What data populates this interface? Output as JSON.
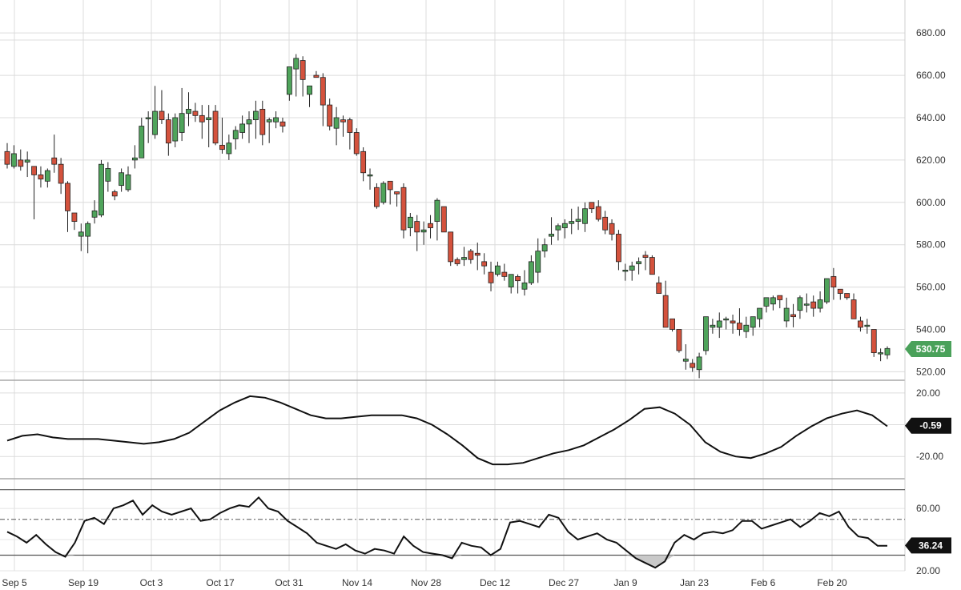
{
  "chart_data": [
    {
      "type": "candlestick",
      "x_tick_labels": [
        "Sep 5",
        "Sep 19",
        "Oct 3",
        "Oct 17",
        "Oct 31",
        "Nov 14",
        "Nov 28",
        "Dec 12",
        "Dec 27",
        "Jan 9",
        "Jan 23",
        "Feb 6",
        "Feb 20"
      ],
      "y_tick_labels": [
        "520.00",
        "540.00",
        "560.00",
        "580.00",
        "600.00",
        "620.00",
        "640.00",
        "660.00",
        "680.00"
      ],
      "ylim": [
        516,
        688
      ],
      "last_value_label": "530.75",
      "last_value": 530.75,
      "grid": true,
      "colors": {
        "up": "#4fa45b",
        "down": "#d4523d",
        "badge": "#4aa15a"
      },
      "candles": [
        [
          624,
          628,
          616,
          618
        ],
        [
          617,
          627,
          616,
          623
        ],
        [
          620,
          625,
          615,
          617
        ],
        [
          619,
          624,
          612,
          620
        ],
        [
          617,
          616,
          592,
          613
        ],
        [
          613,
          617,
          607,
          611
        ],
        [
          610,
          616,
          607,
          615
        ],
        [
          621,
          632,
          614,
          618
        ],
        [
          618,
          621,
          604,
          609
        ],
        [
          609,
          610,
          586,
          596
        ],
        [
          595,
          592,
          587,
          591
        ],
        [
          584,
          590,
          577,
          586
        ],
        [
          584,
          591,
          576,
          590
        ],
        [
          593,
          601,
          590,
          596
        ],
        [
          594,
          620,
          593,
          618
        ],
        [
          610,
          619,
          605,
          616
        ],
        [
          605,
          606,
          601,
          603
        ],
        [
          608,
          616,
          605,
          614
        ],
        [
          606,
          617,
          605,
          613
        ],
        [
          620,
          627,
          616,
          621
        ],
        [
          621,
          640,
          621,
          636
        ],
        [
          640,
          643,
          628,
          640
        ],
        [
          632,
          655,
          630,
          643
        ],
        [
          643,
          653,
          637,
          639
        ],
        [
          639,
          642,
          622,
          628
        ],
        [
          629,
          642,
          626,
          640
        ],
        [
          633,
          654,
          629,
          642
        ],
        [
          642,
          652,
          636,
          644
        ],
        [
          643,
          647,
          638,
          641
        ],
        [
          641,
          646,
          630,
          638
        ],
        [
          639,
          646,
          626,
          640
        ],
        [
          643,
          646,
          627,
          628
        ],
        [
          627,
          640,
          623,
          625
        ],
        [
          623,
          632,
          620,
          628
        ],
        [
          630,
          636,
          625,
          634
        ],
        [
          633,
          641,
          630,
          637
        ],
        [
          637,
          643,
          628,
          639
        ],
        [
          639,
          648,
          630,
          643
        ],
        [
          644,
          648,
          627,
          632
        ],
        [
          638,
          640,
          628,
          639
        ],
        [
          638,
          643,
          635,
          640
        ],
        [
          638,
          640,
          633,
          636
        ],
        [
          651,
          663,
          648,
          664
        ],
        [
          663,
          670,
          650,
          668
        ],
        [
          667,
          669,
          650,
          658
        ],
        [
          651,
          652,
          645,
          655
        ],
        [
          660,
          662,
          660,
          659
        ],
        [
          659,
          661,
          636,
          646
        ],
        [
          646,
          649,
          634,
          636
        ],
        [
          635,
          645,
          627,
          640
        ],
        [
          639,
          641,
          631,
          638
        ],
        [
          639,
          640,
          625,
          633
        ],
        [
          633,
          635,
          622,
          623
        ],
        [
          624,
          626,
          610,
          614
        ],
        [
          613,
          616,
          606,
          613
        ],
        [
          607,
          609,
          597,
          598
        ],
        [
          600,
          610,
          599,
          609
        ],
        [
          610,
          608,
          599,
          606
        ],
        [
          605,
          602,
          598,
          604
        ],
        [
          607,
          609,
          583,
          587
        ],
        [
          588,
          595,
          584,
          593
        ],
        [
          591,
          594,
          577,
          586
        ],
        [
          586,
          591,
          580,
          587
        ],
        [
          590,
          594,
          583,
          588
        ],
        [
          591,
          602,
          582,
          601
        ],
        [
          598,
          596,
          587,
          586
        ],
        [
          586,
          585,
          570,
          572
        ],
        [
          573,
          574,
          570,
          571
        ],
        [
          573,
          579,
          570,
          574
        ],
        [
          577,
          578,
          571,
          573
        ],
        [
          576,
          581,
          568,
          575
        ],
        [
          572,
          576,
          566,
          570
        ],
        [
          567,
          572,
          558,
          562
        ],
        [
          566,
          572,
          565,
          570
        ],
        [
          567,
          571,
          563,
          565
        ],
        [
          560,
          565,
          557,
          566
        ],
        [
          565,
          566,
          557,
          563
        ],
        [
          559,
          568,
          556,
          562
        ],
        [
          562,
          575,
          561,
          572
        ],
        [
          567,
          583,
          562,
          577
        ],
        [
          577,
          583,
          574,
          580
        ],
        [
          584,
          593,
          580,
          585
        ],
        [
          587,
          590,
          582,
          589
        ],
        [
          588,
          592,
          583,
          590
        ],
        [
          590,
          597,
          585,
          591
        ],
        [
          591,
          598,
          587,
          592
        ],
        [
          590,
          600,
          586,
          597
        ],
        [
          600,
          596,
          595,
          597
        ],
        [
          598,
          601,
          591,
          592
        ],
        [
          593,
          596,
          585,
          587
        ],
        [
          590,
          592,
          582,
          585
        ],
        [
          585,
          587,
          568,
          572
        ],
        [
          568,
          571,
          563,
          568
        ],
        [
          568,
          572,
          563,
          570
        ],
        [
          571,
          574,
          566,
          572
        ],
        [
          575,
          577,
          568,
          574
        ],
        [
          574,
          575,
          567,
          566
        ],
        [
          562,
          565,
          558,
          557
        ],
        [
          556,
          563,
          543,
          541
        ],
        [
          545,
          542,
          539,
          540
        ],
        [
          540,
          538,
          529,
          530
        ],
        [
          525,
          533,
          521,
          526
        ],
        [
          524,
          526,
          520,
          522
        ],
        [
          521,
          529,
          517,
          527
        ],
        [
          530,
          545,
          528,
          546
        ],
        [
          541,
          545,
          538,
          542
        ],
        [
          541,
          548,
          536,
          544
        ],
        [
          545,
          546,
          540,
          545
        ],
        [
          544,
          547,
          538,
          543
        ],
        [
          543,
          550,
          537,
          540
        ],
        [
          539,
          546,
          536,
          542
        ],
        [
          541,
          545,
          537,
          546
        ],
        [
          545,
          550,
          541,
          550
        ],
        [
          551,
          553,
          548,
          555
        ],
        [
          552,
          556,
          549,
          555
        ],
        [
          556,
          555,
          550,
          554
        ],
        [
          544,
          555,
          541,
          550
        ],
        [
          547,
          552,
          541,
          546
        ],
        [
          549,
          556,
          545,
          555
        ],
        [
          552,
          557,
          548,
          552
        ],
        [
          553,
          556,
          546,
          550
        ],
        [
          550,
          558,
          548,
          554
        ],
        [
          553,
          561,
          552,
          564
        ],
        [
          565,
          569,
          554,
          560
        ],
        [
          559,
          558,
          554,
          557
        ],
        [
          557,
          557,
          554,
          555
        ],
        [
          554,
          557,
          545,
          545
        ],
        [
          544,
          546,
          539,
          541
        ],
        [
          542,
          545,
          538,
          542
        ],
        [
          540,
          540,
          527,
          529
        ],
        [
          529,
          531,
          525,
          529
        ],
        [
          528,
          532,
          526,
          531
        ]
      ]
    },
    {
      "type": "line",
      "y_tick_labels": [
        "20.00",
        "-20.00"
      ],
      "ylim": [
        -34,
        27
      ],
      "last_value_label": "-0.59",
      "last_value": -0.59,
      "values": [
        -10,
        -7,
        -6,
        -8,
        -9,
        -9,
        -9,
        -10,
        -11,
        -12,
        -11,
        -9,
        -5,
        2,
        9,
        14,
        18,
        17,
        14,
        10,
        6,
        4,
        4,
        5,
        6,
        6,
        6,
        4,
        0,
        -6,
        -13,
        -21,
        -25,
        -25,
        -24,
        -21,
        -18,
        -16,
        -13,
        -8,
        -3,
        3,
        10,
        11,
        7,
        0,
        -11,
        -17,
        -20,
        -21,
        -18,
        -14,
        -7,
        -1,
        4,
        7,
        9,
        6,
        -1
      ]
    },
    {
      "type": "line",
      "y_tick_labels": [
        "60.00",
        "20.00"
      ],
      "ylim": [
        20,
        78
      ],
      "last_value_label": "36.24",
      "last_value": 36.24,
      "levels": [
        72,
        53,
        30
      ],
      "values": [
        45,
        42,
        38,
        43,
        37,
        32,
        29,
        38,
        52,
        54,
        50,
        60,
        62,
        65,
        56,
        62,
        58,
        56,
        58,
        60,
        52,
        53,
        57,
        60,
        62,
        61,
        67,
        60,
        58,
        52,
        48,
        44,
        38,
        36,
        34,
        37,
        33,
        31,
        34,
        33,
        31,
        42,
        36,
        32,
        31,
        30,
        28,
        38,
        36,
        35,
        30,
        34,
        51,
        52,
        50,
        48,
        56,
        54,
        45,
        40,
        42,
        44,
        40,
        38,
        33,
        28,
        25,
        22,
        26,
        38,
        43,
        40,
        44,
        45,
        44,
        46,
        52,
        52,
        47,
        49,
        51,
        53,
        48,
        52,
        57,
        55,
        58,
        48,
        42,
        41,
        36,
        36
      ]
    }
  ]
}
